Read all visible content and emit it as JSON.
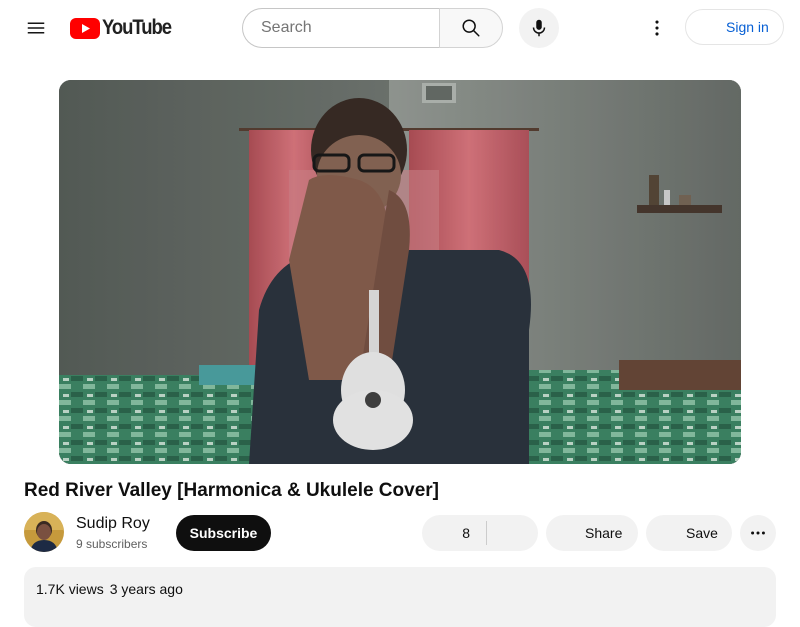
{
  "header": {
    "logo_text": "YouTube",
    "search_placeholder": "Search",
    "signin_label": "Sign in"
  },
  "video": {
    "title": "Red River Valley [Harmonica & Ukulele Cover]",
    "views": "1.7K views",
    "age": "3 years ago"
  },
  "channel": {
    "name": "Sudip Roy",
    "subscribers": "9 subscribers",
    "subscribe_label": "Subscribe"
  },
  "actions": {
    "like_count": "8",
    "share_label": "Share",
    "save_label": "Save"
  },
  "icons": {
    "menu": "hamburger-menu-icon",
    "logo": "youtube-logo-icon",
    "search": "search-icon",
    "mic": "microphone-icon",
    "more": "more-vertical-icon",
    "account": "account-circle-icon",
    "like": "thumbs-up-icon",
    "dislike": "thumbs-down-icon",
    "share": "share-arrow-icon",
    "save": "playlist-add-icon",
    "actions_more": "more-horizontal-icon"
  },
  "colors": {
    "brand_red": "#ff0000",
    "link_blue": "#065fd4",
    "chip_bg": "#f2f2f2",
    "subscribe_bg": "#0f0f0f"
  }
}
